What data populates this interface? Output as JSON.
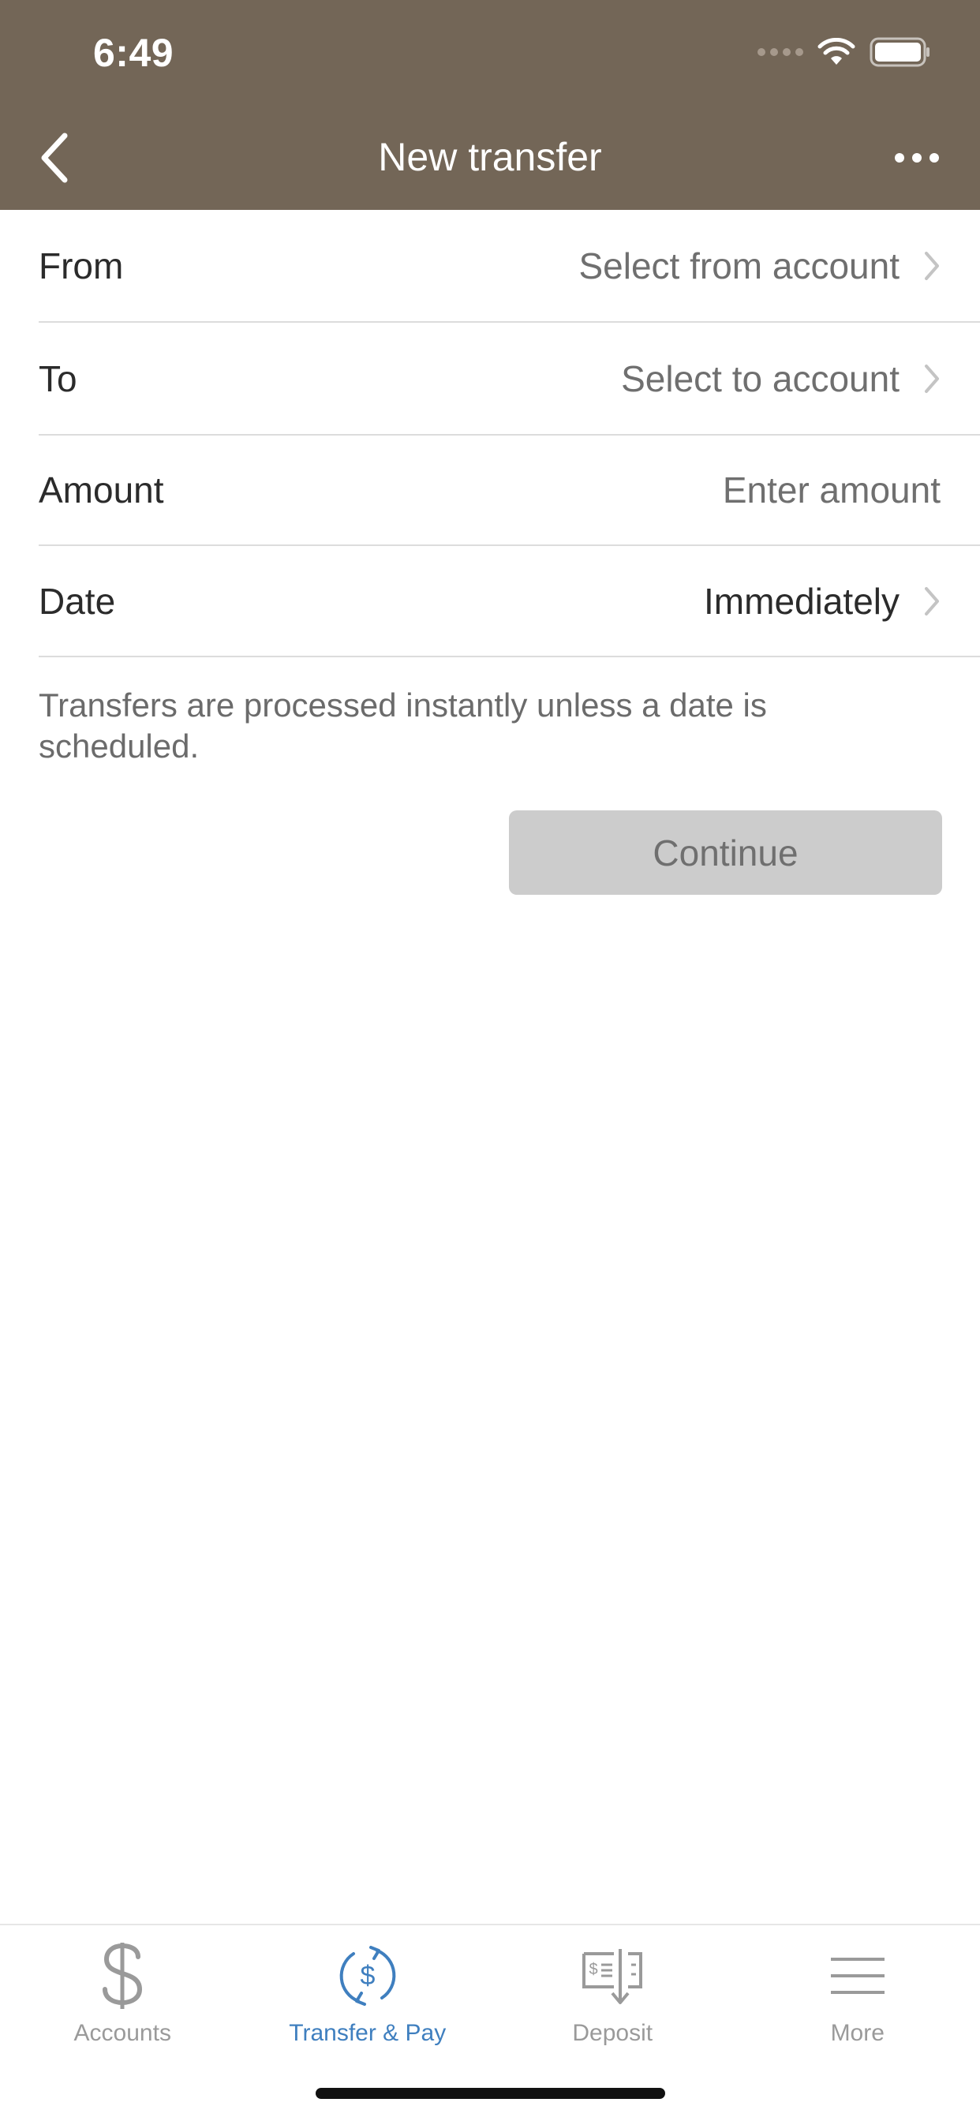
{
  "status_bar": {
    "time": "6:49"
  },
  "header": {
    "title": "New transfer",
    "background": "#736657"
  },
  "form": {
    "from": {
      "label": "From",
      "value": "Select from account"
    },
    "to": {
      "label": "To",
      "value": "Select to account"
    },
    "amount": {
      "label": "Amount",
      "placeholder": "Enter amount"
    },
    "date": {
      "label": "Date",
      "value": "Immediately"
    }
  },
  "help_text": "Transfers are processed instantly unless a date is scheduled.",
  "continue_label": "Continue",
  "tabs": [
    {
      "label": "Accounts",
      "icon": "dollar-icon",
      "active": false
    },
    {
      "label": "Transfer & Pay",
      "icon": "transfer-pay-icon",
      "active": true
    },
    {
      "label": "Deposit",
      "icon": "check-deposit-icon",
      "active": false
    },
    {
      "label": "More",
      "icon": "menu-icon",
      "active": false
    }
  ],
  "colors": {
    "header_bg": "#736657",
    "accent": "#3f7fbf",
    "button_disabled": "#cccccc"
  }
}
